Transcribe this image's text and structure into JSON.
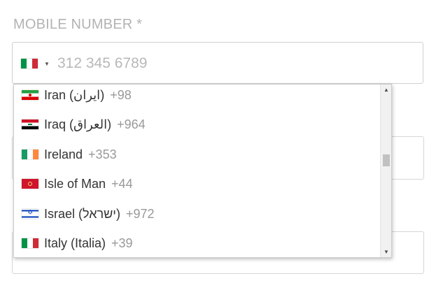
{
  "form": {
    "mobile_label": "MOBILE NUMBER *",
    "phone_placeholder": "312 345 6789",
    "selected_country_icon": "italy-flag-icon"
  },
  "dropdown": {
    "items": [
      {
        "icon": "iran-flag-icon",
        "name": "Iran (ایران)",
        "code": "+98"
      },
      {
        "icon": "iraq-flag-icon",
        "name": "Iraq (العراق)",
        "code": "+964"
      },
      {
        "icon": "ireland-flag-icon",
        "name": "Ireland",
        "code": "+353"
      },
      {
        "icon": "isle-of-man-flag-icon",
        "name": "Isle of Man",
        "code": "+44"
      },
      {
        "icon": "israel-flag-icon",
        "name": "Israel (ישראל)",
        "code": "+972"
      },
      {
        "icon": "italy-flag-icon",
        "name": "Italy (Italia)",
        "code": "+39"
      }
    ]
  },
  "colors": {
    "label": "#b3b3b3",
    "border": "#cfcfcf",
    "dial_code": "#999999"
  }
}
